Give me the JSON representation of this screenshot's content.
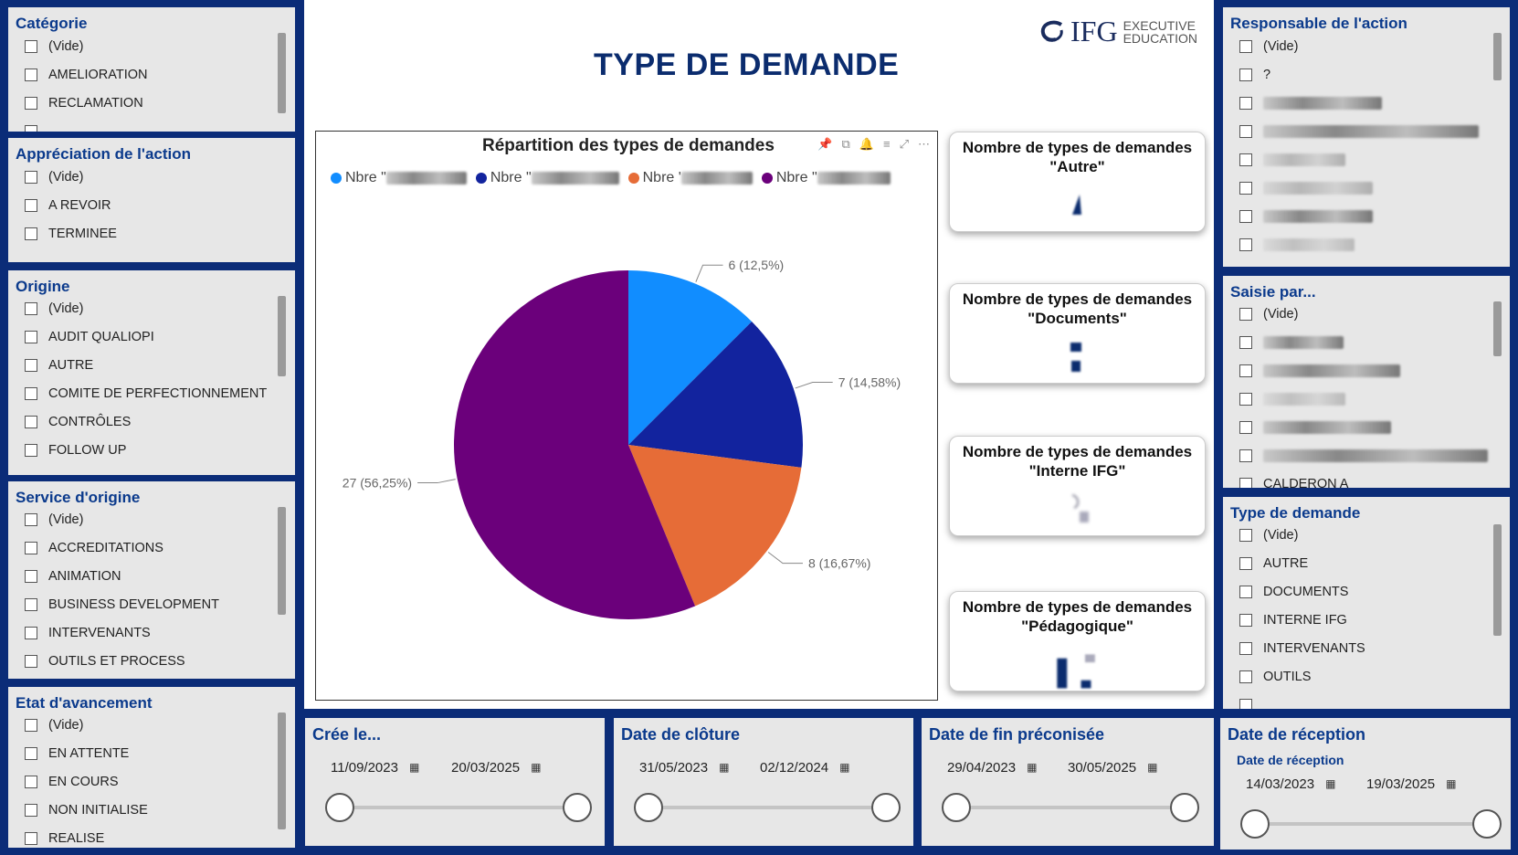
{
  "page": {
    "title": "TYPE DE DEMANDE",
    "logo_text": "IFG",
    "logo_sub_1": "EXECUTIVE",
    "logo_sub_2": "EDUCATION"
  },
  "left_slicers": [
    {
      "title": "Catégorie",
      "items": [
        "(Vide)",
        "AMELIORATION",
        "RECLAMATION"
      ]
    },
    {
      "title": "Appréciation de l'action",
      "items": [
        "(Vide)",
        "A REVOIR",
        "TERMINEE"
      ]
    },
    {
      "title": "Origine",
      "items": [
        "(Vide)",
        "AUDIT QUALIOPI",
        "AUTRE",
        "COMITE DE PERFECTIONNEMENT",
        "CONTRÔLES",
        "FOLLOW UP"
      ]
    },
    {
      "title": "Service d'origine",
      "items": [
        "(Vide)",
        "ACCREDITATIONS",
        "ANIMATION",
        "BUSINESS DEVELOPMENT",
        "INTERVENANTS",
        "OUTILS ET PROCESS"
      ]
    },
    {
      "title": "Etat d'avancement",
      "items": [
        "(Vide)",
        "EN ATTENTE",
        "EN COURS",
        "NON INITIALISE",
        "REALISE"
      ]
    }
  ],
  "right_slicers": [
    {
      "title": "Responsable de l'action",
      "items": [
        "(Vide)",
        "?",
        "",
        "",
        "",
        "",
        "",
        ""
      ]
    },
    {
      "title": "Saisie par...",
      "items": [
        "(Vide)",
        "",
        "",
        "",
        "",
        "",
        "CALDERON A"
      ]
    },
    {
      "title": "Type de demande",
      "items": [
        "(Vide)",
        "AUTRE",
        "DOCUMENTS",
        "INTERNE IFG",
        "INTERVENANTS",
        "OUTILS"
      ]
    }
  ],
  "chart": {
    "title": "Répartition des types de demandes",
    "legend": [
      {
        "label": "Nbre \"",
        "color": "#118dff"
      },
      {
        "label": "Nbre \"",
        "color": "#12239e"
      },
      {
        "label": "Nbre '",
        "color": "#e66c37"
      },
      {
        "label": "Nbre \"",
        "color": "#6b007b"
      }
    ],
    "labels": [
      "6 (12,5%)",
      "7 (14,58%)",
      "8 (16,67%)",
      "27 (56,25%)"
    ]
  },
  "chart_data": {
    "type": "pie",
    "title": "Répartition des types de demandes",
    "values": [
      6,
      7,
      8,
      27
    ],
    "percent_labels": [
      "12,5%",
      "14,58%",
      "16,67%",
      "56,25%"
    ],
    "colors": [
      "#118dff",
      "#12239e",
      "#e66c37",
      "#6b007b"
    ]
  },
  "cards": [
    {
      "title_1": "Nombre de types de demandes",
      "title_2": "\"Autre\""
    },
    {
      "title_1": "Nombre de types de demandes",
      "title_2": "\"Documents\""
    },
    {
      "title_1": "Nombre de types de demandes",
      "title_2": "\"Interne IFG\""
    },
    {
      "title_1": "Nombre de types de demandes",
      "title_2": "\"Pédagogique\""
    }
  ],
  "date_slicers": [
    {
      "title": "Crée le...",
      "subtitle": "",
      "start": "11/09/2023",
      "end": "20/03/2025"
    },
    {
      "title": "Date de clôture",
      "subtitle": "",
      "start": "31/05/2023",
      "end": "02/12/2024"
    },
    {
      "title": "Date de fin préconisée",
      "subtitle": "",
      "start": "29/04/2023",
      "end": "30/05/2025"
    },
    {
      "title": "Date de réception",
      "subtitle": "Date de réception",
      "start": "14/03/2023",
      "end": "19/03/2025"
    }
  ]
}
